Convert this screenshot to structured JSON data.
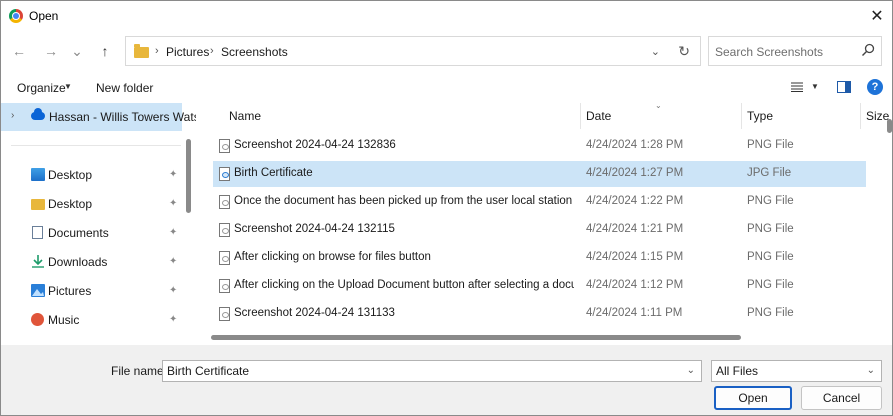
{
  "window": {
    "title": "Open",
    "close_glyph": "✕"
  },
  "nav": {
    "back_glyph": "←",
    "forward_glyph": "→",
    "recent_glyph": "⌄",
    "up_glyph": "↑",
    "breadcrumb": [
      "Pictures",
      "Screenshots"
    ],
    "crumb_separator": "›",
    "dropdown_glyph": "⌄",
    "refresh_glyph": "↻",
    "search_placeholder": "Search Screenshots"
  },
  "toolbar": {
    "organize_label": "Organize",
    "new_folder_label": "New folder",
    "help_glyph": "?"
  },
  "sidebar": {
    "top_item": "Hassan - Willis Towers Watson",
    "items": [
      {
        "label": "Desktop",
        "icon": "desktop-icon"
      },
      {
        "label": "Desktop",
        "icon": "folder-icon"
      },
      {
        "label": "Documents",
        "icon": "documents-icon"
      },
      {
        "label": "Downloads",
        "icon": "downloads-icon"
      },
      {
        "label": "Pictures",
        "icon": "pictures-icon"
      },
      {
        "label": "Music",
        "icon": "music-icon"
      }
    ],
    "pin_glyph": "📌"
  },
  "columns": {
    "name": "Name",
    "date": "Date",
    "type": "Type",
    "size": "Size"
  },
  "files": [
    {
      "name": "Screenshot 2024-04-24 132836",
      "date": "4/24/2024 1:28 PM",
      "type": "PNG File",
      "selected": false
    },
    {
      "name": "Birth Certificate",
      "date": "4/24/2024 1:27 PM",
      "type": "JPG File",
      "selected": true
    },
    {
      "name": "Once the document has been picked up from the user local station",
      "date": "4/24/2024 1:22 PM",
      "type": "PNG File",
      "selected": false
    },
    {
      "name": "Screenshot 2024-04-24 132115",
      "date": "4/24/2024 1:21 PM",
      "type": "PNG File",
      "selected": false
    },
    {
      "name": "After clicking on browse for files button",
      "date": "4/24/2024 1:15 PM",
      "type": "PNG File",
      "selected": false
    },
    {
      "name": "After clicking on the Upload Document button after selecting a docu...",
      "date": "4/24/2024 1:12 PM",
      "type": "PNG File",
      "selected": false
    },
    {
      "name": "Screenshot 2024-04-24 131133",
      "date": "4/24/2024 1:11 PM",
      "type": "PNG File",
      "selected": false
    }
  ],
  "footer": {
    "file_name_label": "File name:",
    "file_name_value": "Birth Certificate",
    "filter_value": "All Files",
    "open_label": "Open",
    "cancel_label": "Cancel",
    "caret_glyph": "⌄"
  },
  "colors": {
    "selection": "#cce4f7",
    "accent": "#1a60c4"
  }
}
